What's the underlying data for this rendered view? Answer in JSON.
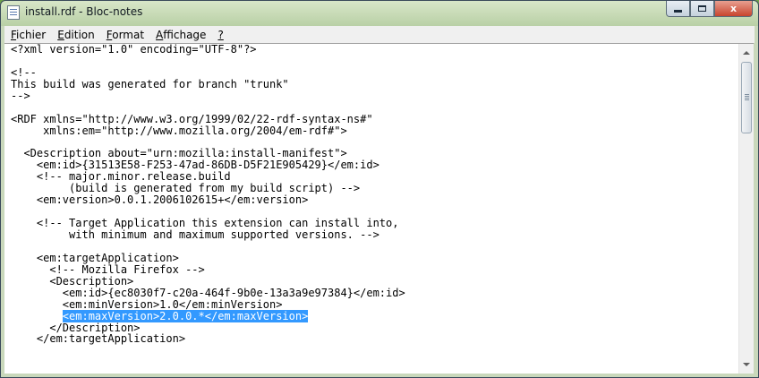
{
  "window": {
    "title": "install.rdf - Bloc-notes"
  },
  "controls": {
    "minimize": "minimize",
    "maximize": "maximize",
    "close": "x"
  },
  "menu": [
    {
      "ul": "F",
      "rest": "ichier"
    },
    {
      "ul": "E",
      "rest": "dition"
    },
    {
      "ul": "F",
      "rest": "ormat"
    },
    {
      "ul": "A",
      "rest": "ffichage"
    },
    {
      "ul": "?",
      "rest": ""
    }
  ],
  "document": {
    "lines": [
      "<?xml version=\"1.0\" encoding=\"UTF-8\"?>",
      "",
      "<!--",
      "This build was generated for branch \"trunk\"",
      "-->",
      "",
      "<RDF xmlns=\"http://www.w3.org/1999/02/22-rdf-syntax-ns#\"",
      "     xmlns:em=\"http://www.mozilla.org/2004/em-rdf#\">",
      "",
      "  <Description about=\"urn:mozilla:install-manifest\">",
      "    <em:id>{31513E58-F253-47ad-86DB-D5F21E905429}</em:id>",
      "    <!-- major.minor.release.build",
      "         (build is generated from my build script) -->",
      "    <em:version>0.0.1.2006102615+</em:version>",
      "",
      "    <!-- Target Application this extension can install into,",
      "         with minimum and maximum supported versions. -->",
      "",
      "    <em:targetApplication>",
      "      <!-- Mozilla Firefox -->",
      "      <Description>",
      "        <em:id>{ec8030f7-c20a-464f-9b0e-13a3a9e97384}</em:id>",
      "        <em:minVersion>1.0</em:minVersion>",
      "        ",
      "      </Description>",
      "    </em:targetApplication>"
    ],
    "selected_line_index": 23,
    "selected_indent": "        ",
    "selected_text": "<em:maxVersion>2.0.0.*</em:maxVersion>"
  }
}
